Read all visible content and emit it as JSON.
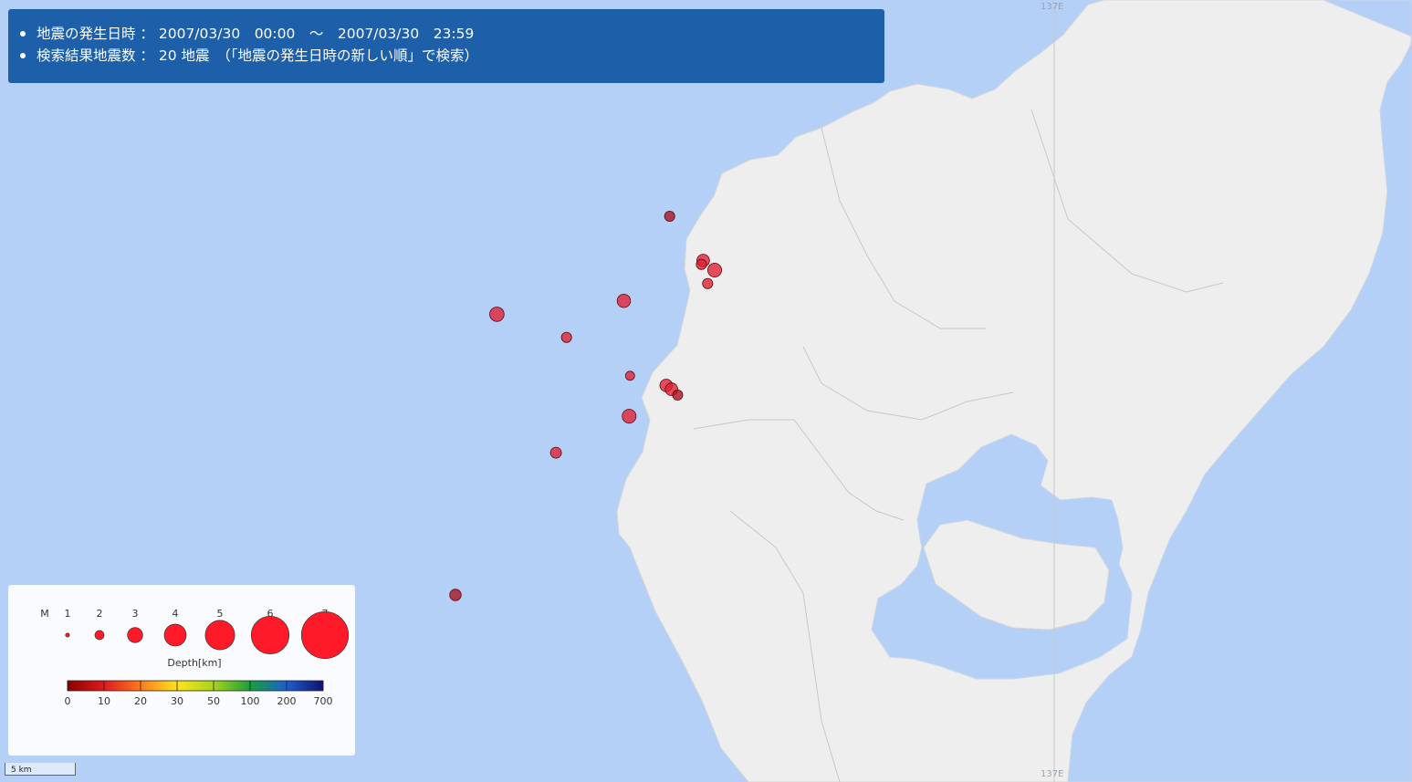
{
  "info": {
    "line1": "地震の発生日時 ： 2007/03/30　00:00　～　2007/03/30　23:59",
    "line2": "検索結果地震数 ： 20 地震　（「地震の発生日時の新しい順」で検索）"
  },
  "grid": {
    "top_label": "137E",
    "bottom_label": "137E"
  },
  "scale": {
    "label": "5 km"
  },
  "legend": {
    "magnitude_label": "M",
    "magnitudes": [
      "1",
      "2",
      "3",
      "4",
      "5",
      "6",
      "7"
    ],
    "depth_title": "Depth[km]",
    "depth_ticks": [
      "0",
      "10",
      "20",
      "30",
      "50",
      "100",
      "200",
      "700"
    ],
    "depth_colors": [
      "#8b0000",
      "#e0191e",
      "#ff7a1c",
      "#ffe41a",
      "#a8d41a",
      "#18a03a",
      "#1a5fd0",
      "#14106e"
    ]
  },
  "colors": {
    "sea": "#b5d0f7",
    "land": "#eeeeee",
    "panel": "#1e5faa",
    "quake_shallow": "#e21f33",
    "quake_dark": "#a8101e"
  },
  "earthquakes": [
    {
      "lon": 136.707,
      "lat": 37.408,
      "mag": 2.2,
      "depth": 4
    },
    {
      "lon": 136.758,
      "lat": 37.38,
      "mag": 2.8,
      "depth": 11
    },
    {
      "lon": 136.745,
      "lat": 37.385,
      "mag": 2.6,
      "depth": 10
    },
    {
      "lon": 136.743,
      "lat": 37.383,
      "mag": 2.2,
      "depth": 10
    },
    {
      "lon": 136.75,
      "lat": 37.373,
      "mag": 2.2,
      "depth": 11
    },
    {
      "lon": 136.655,
      "lat": 37.364,
      "mag": 2.7,
      "depth": 11
    },
    {
      "lon": 136.511,
      "lat": 37.357,
      "mag": 2.9,
      "depth": 10
    },
    {
      "lon": 136.59,
      "lat": 37.345,
      "mag": 2.2,
      "depth": 9
    },
    {
      "lon": 136.662,
      "lat": 37.325,
      "mag": 2.0,
      "depth": 8
    },
    {
      "lon": 136.703,
      "lat": 37.32,
      "mag": 2.6,
      "depth": 11
    },
    {
      "lon": 136.709,
      "lat": 37.318,
      "mag": 2.6,
      "depth": 11
    },
    {
      "lon": 136.716,
      "lat": 37.315,
      "mag": 2.2,
      "depth": 5
    },
    {
      "lon": 136.661,
      "lat": 37.304,
      "mag": 2.8,
      "depth": 12
    },
    {
      "lon": 136.578,
      "lat": 37.285,
      "mag": 2.3,
      "depth": 12
    },
    {
      "lon": 136.464,
      "lat": 37.211,
      "mag": 2.4,
      "depth": 3
    }
  ]
}
